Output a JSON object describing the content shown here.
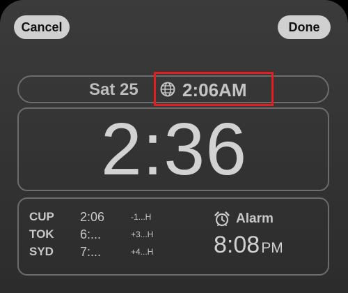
{
  "header": {
    "cancel_label": "Cancel",
    "done_label": "Done"
  },
  "date_widget": {
    "date": "Sat 25",
    "world_time": "2:06AM",
    "globe_icon": "globe-icon"
  },
  "clock": {
    "time": "2:36"
  },
  "world_clock": {
    "cities": [
      {
        "code": "CUP",
        "time": "2:06",
        "offset": "-1...H"
      },
      {
        "code": "TOK",
        "time": "6:...",
        "offset": "+3...H"
      },
      {
        "code": "SYD",
        "time": "7:...",
        "offset": "+4...H"
      }
    ]
  },
  "alarm": {
    "label": "Alarm",
    "time": "8:08",
    "period": "PM",
    "icon": "alarm-clock-icon"
  },
  "colors": {
    "highlight": "#e02020",
    "button_bg": "#d0d0d0",
    "text": "#c8c8c8"
  }
}
